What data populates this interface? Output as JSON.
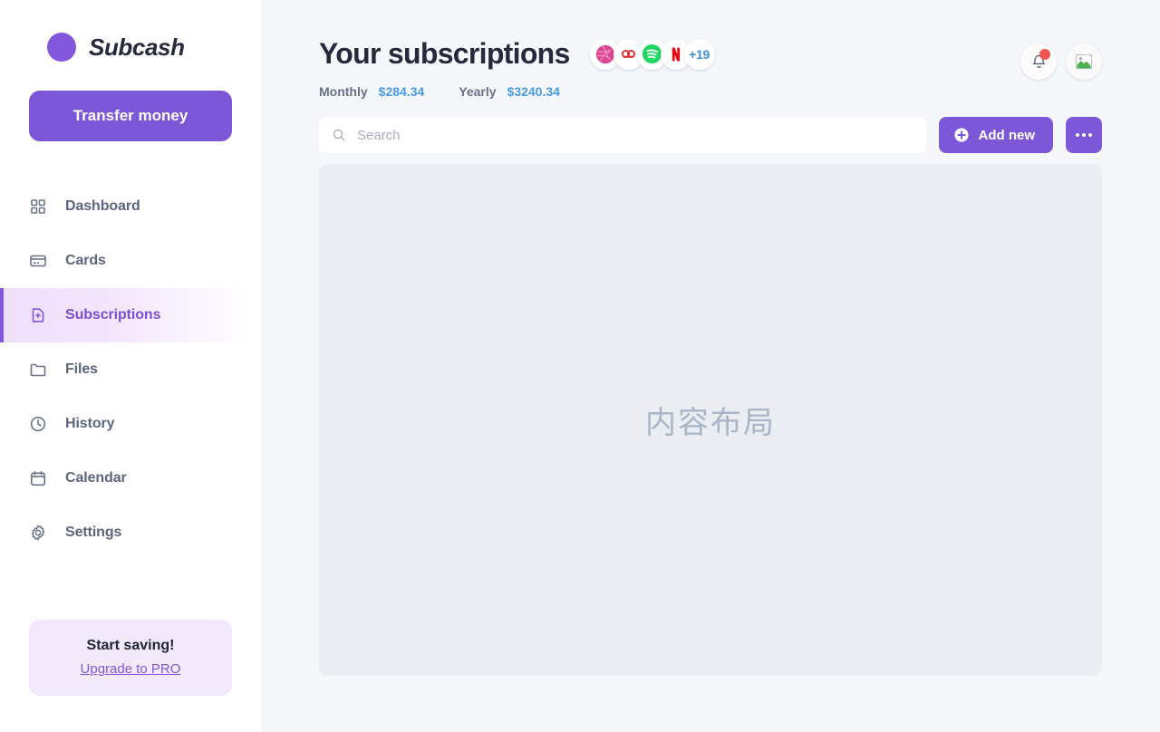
{
  "sidebar": {
    "brand": {
      "name": "Subcash",
      "logo_icon": "purple-circle-logo"
    },
    "transfer_button": "Transfer money",
    "items": [
      {
        "label": "Dashboard",
        "icon": "grid-icon",
        "active": false
      },
      {
        "label": "Cards",
        "icon": "credit-card-icon",
        "active": false
      },
      {
        "label": "Subscriptions",
        "icon": "file-plus-icon",
        "active": true
      },
      {
        "label": "Files",
        "icon": "folder-icon",
        "active": false
      },
      {
        "label": "History",
        "icon": "clock-icon",
        "active": false
      },
      {
        "label": "Calendar",
        "icon": "calendar-icon",
        "active": false
      },
      {
        "label": "Settings",
        "icon": "gear-icon",
        "active": false
      }
    ],
    "promo": {
      "title": "Start saving!",
      "link": "Upgrade to PRO"
    }
  },
  "header": {
    "title": "Your subscriptions",
    "brand_chips": [
      {
        "name": "dribbble-icon",
        "label": ""
      },
      {
        "name": "adobe-creative-cloud-icon",
        "label": ""
      },
      {
        "name": "spotify-icon",
        "label": ""
      },
      {
        "name": "netflix-icon",
        "label": ""
      }
    ],
    "more_count": "+19",
    "stats": [
      {
        "label": "Monthly",
        "value": "$284.34"
      },
      {
        "label": "Yearly",
        "value": "$3240.34"
      }
    ],
    "notifications": {
      "icon": "bell-icon",
      "has_unread": true
    },
    "avatar": {
      "icon": "broken-image-icon"
    }
  },
  "toolbar": {
    "search_placeholder": "Search",
    "search_value": "",
    "search_icon": "search-icon",
    "add_label": "Add new",
    "add_icon": "plus-circle-icon",
    "more_icon": "ellipsis-icon"
  },
  "content": {
    "placeholder_text": "内容布局"
  },
  "colors": {
    "accent_purple": "#7c58d8",
    "active_purple": "#8257dd",
    "stat_blue": "#4a9ae3",
    "page_bg": "#f4f8fb",
    "panel_bg": "#eaeef2",
    "badge_red": "#f0544f"
  }
}
